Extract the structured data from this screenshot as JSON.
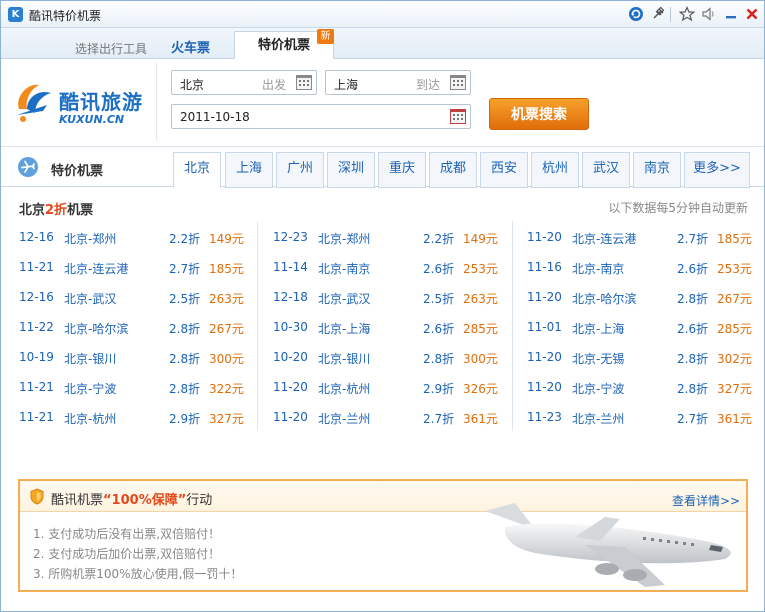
{
  "window": {
    "title": "酷讯特价机票"
  },
  "toolbar": {
    "refresh_icon": "refresh-icon",
    "pin_icon": "pin-icon",
    "star_icon": "star-icon",
    "sound_icon": "speaker-icon",
    "minimize_icon": "minimize-icon",
    "close_icon": "close-icon"
  },
  "tabs": {
    "tool_label": "选择出行工具",
    "train": "火车票",
    "flight": "特价机票",
    "new_badge": "新"
  },
  "logo": {
    "cn": "酷讯旅游",
    "en": "KUXUN.CN"
  },
  "search": {
    "from_value": "北京",
    "from_hint": "出发",
    "to_value": "上海",
    "to_hint": "到达",
    "date_value": "2011-10-18",
    "button": "机票搜索"
  },
  "section": {
    "title": "特价机票",
    "cities": [
      "北京",
      "上海",
      "广州",
      "深圳",
      "重庆",
      "成都",
      "西安",
      "杭州",
      "武汉",
      "南京",
      "更多>>"
    ],
    "active_city": "北京"
  },
  "deals": {
    "heading_prefix": "北京",
    "heading_highlight": "2折",
    "heading_suffix": "机票",
    "refresh_note": "以下数据每5分钟自动更新",
    "columns": [
      [
        {
          "date": "12-16",
          "route": "北京-郑州",
          "discount": "2.2折",
          "price": "149元"
        },
        {
          "date": "11-21",
          "route": "北京-连云港",
          "discount": "2.7折",
          "price": "185元"
        },
        {
          "date": "12-16",
          "route": "北京-武汉",
          "discount": "2.5折",
          "price": "263元"
        },
        {
          "date": "11-22",
          "route": "北京-哈尔滨",
          "discount": "2.8折",
          "price": "267元"
        },
        {
          "date": "10-19",
          "route": "北京-银川",
          "discount": "2.8折",
          "price": "300元"
        },
        {
          "date": "11-21",
          "route": "北京-宁波",
          "discount": "2.8折",
          "price": "322元"
        },
        {
          "date": "11-21",
          "route": "北京-杭州",
          "discount": "2.9折",
          "price": "327元"
        }
      ],
      [
        {
          "date": "12-23",
          "route": "北京-郑州",
          "discount": "2.2折",
          "price": "149元"
        },
        {
          "date": "11-14",
          "route": "北京-南京",
          "discount": "2.6折",
          "price": "253元"
        },
        {
          "date": "12-18",
          "route": "北京-武汉",
          "discount": "2.5折",
          "price": "263元"
        },
        {
          "date": "10-30",
          "route": "北京-上海",
          "discount": "2.6折",
          "price": "285元"
        },
        {
          "date": "10-20",
          "route": "北京-银川",
          "discount": "2.8折",
          "price": "300元"
        },
        {
          "date": "11-20",
          "route": "北京-杭州",
          "discount": "2.9折",
          "price": "326元"
        },
        {
          "date": "11-20",
          "route": "北京-兰州",
          "discount": "2.7折",
          "price": "361元"
        }
      ],
      [
        {
          "date": "11-20",
          "route": "北京-连云港",
          "discount": "2.7折",
          "price": "185元"
        },
        {
          "date": "11-16",
          "route": "北京-南京",
          "discount": "2.6折",
          "price": "253元"
        },
        {
          "date": "11-20",
          "route": "北京-哈尔滨",
          "discount": "2.8折",
          "price": "267元"
        },
        {
          "date": "11-01",
          "route": "北京-上海",
          "discount": "2.6折",
          "price": "285元"
        },
        {
          "date": "11-20",
          "route": "北京-无锡",
          "discount": "2.8折",
          "price": "302元"
        },
        {
          "date": "11-20",
          "route": "北京-宁波",
          "discount": "2.8折",
          "price": "327元"
        },
        {
          "date": "11-23",
          "route": "北京-兰州",
          "discount": "2.7折",
          "price": "361元"
        }
      ]
    ]
  },
  "promo": {
    "title_prefix": "酷讯机票",
    "title_highlight": "“100%保障”",
    "title_suffix": "行动",
    "more": "查看详情>>",
    "items": [
      "1. 支付成功后没有出票,双倍赔付！",
      "2. 支付成功后加价出票,双倍赔付！",
      "3. 所购机票100%放心使用,假一罚十！"
    ]
  },
  "colors": {
    "accent_blue": "#1b62b6",
    "price_orange": "#e06d09",
    "highlight_red": "#e24a1b",
    "promo_border": "#f3ae53"
  }
}
